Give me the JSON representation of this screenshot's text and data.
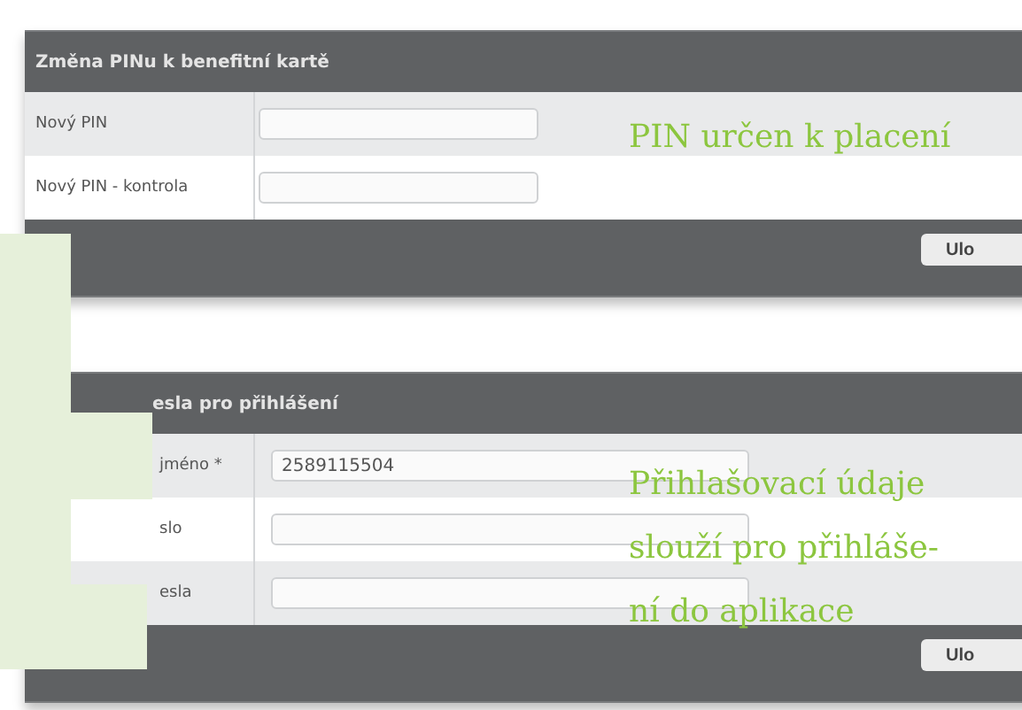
{
  "sections": [
    {
      "title": "Změna PINu k benefitní kartě",
      "fields": [
        {
          "label": "Nový PIN"
        },
        {
          "label": "Nový PIN - kontrola"
        }
      ],
      "button": "Ulo",
      "note_lines": [
        "PIN určen k placení"
      ]
    },
    {
      "title": "esla pro přihlášení",
      "fields": [
        {
          "label": "jméno *",
          "value": "2589115504"
        },
        {
          "label": "slo"
        },
        {
          "label": "esla"
        }
      ],
      "button": "Ulo",
      "note_lines": [
        "Přihlašovací údaje",
        "slouží pro přihláše-",
        "ní do aplikace"
      ]
    }
  ]
}
